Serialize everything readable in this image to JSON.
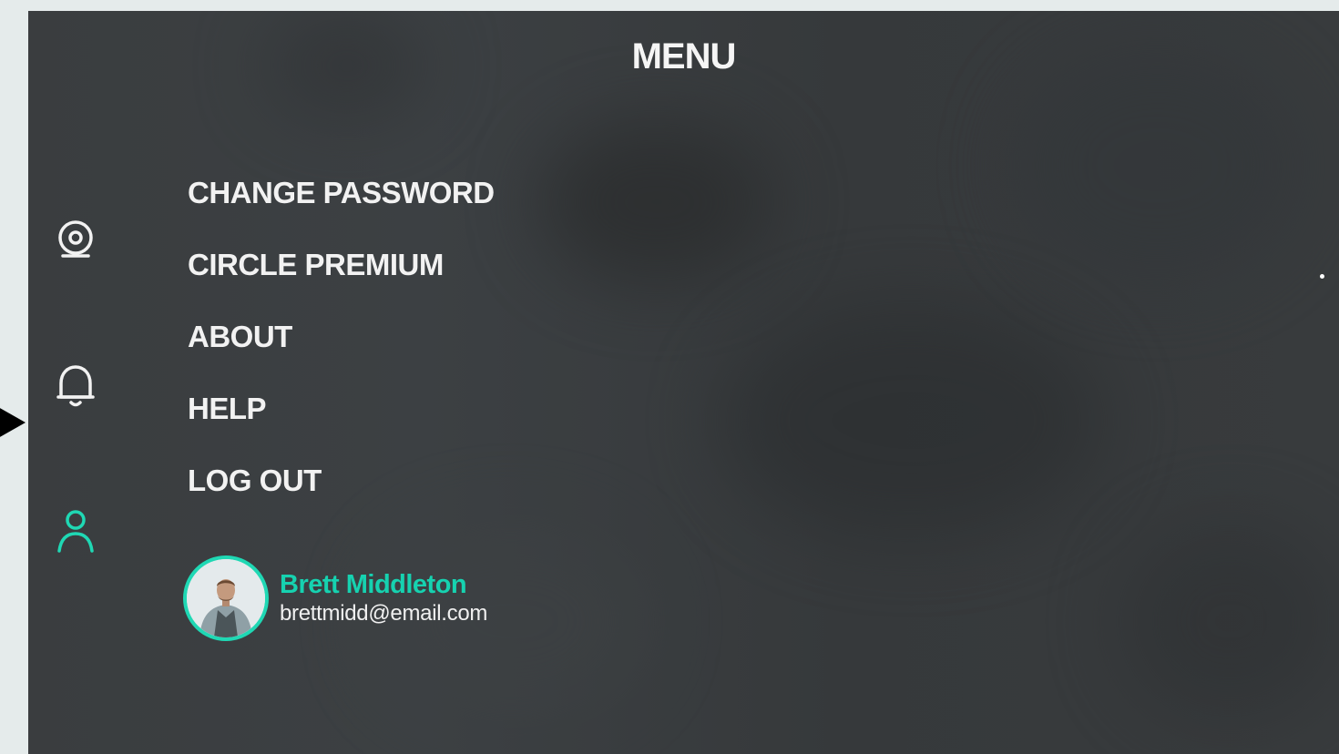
{
  "menu": {
    "title": "MENU"
  },
  "sidebar": {
    "items": [
      {
        "icon": "webcam-icon",
        "active": false
      },
      {
        "icon": "bell-icon",
        "active": false
      },
      {
        "icon": "user-icon",
        "active": true
      }
    ]
  },
  "menu_items": [
    {
      "label": "CHANGE PASSWORD"
    },
    {
      "label": "CIRCLE PREMIUM"
    },
    {
      "label": "ABOUT"
    },
    {
      "label": "HELP"
    },
    {
      "label": "LOG OUT"
    }
  ],
  "profile": {
    "name": "Brett Middleton",
    "email": "brettmidd@email.com",
    "avatar": "profile-photo"
  },
  "colors": {
    "accent": "#1fd8b4",
    "text": "#f2f2f2",
    "background": "#3a3d3f",
    "page": "#e5ebeb"
  }
}
